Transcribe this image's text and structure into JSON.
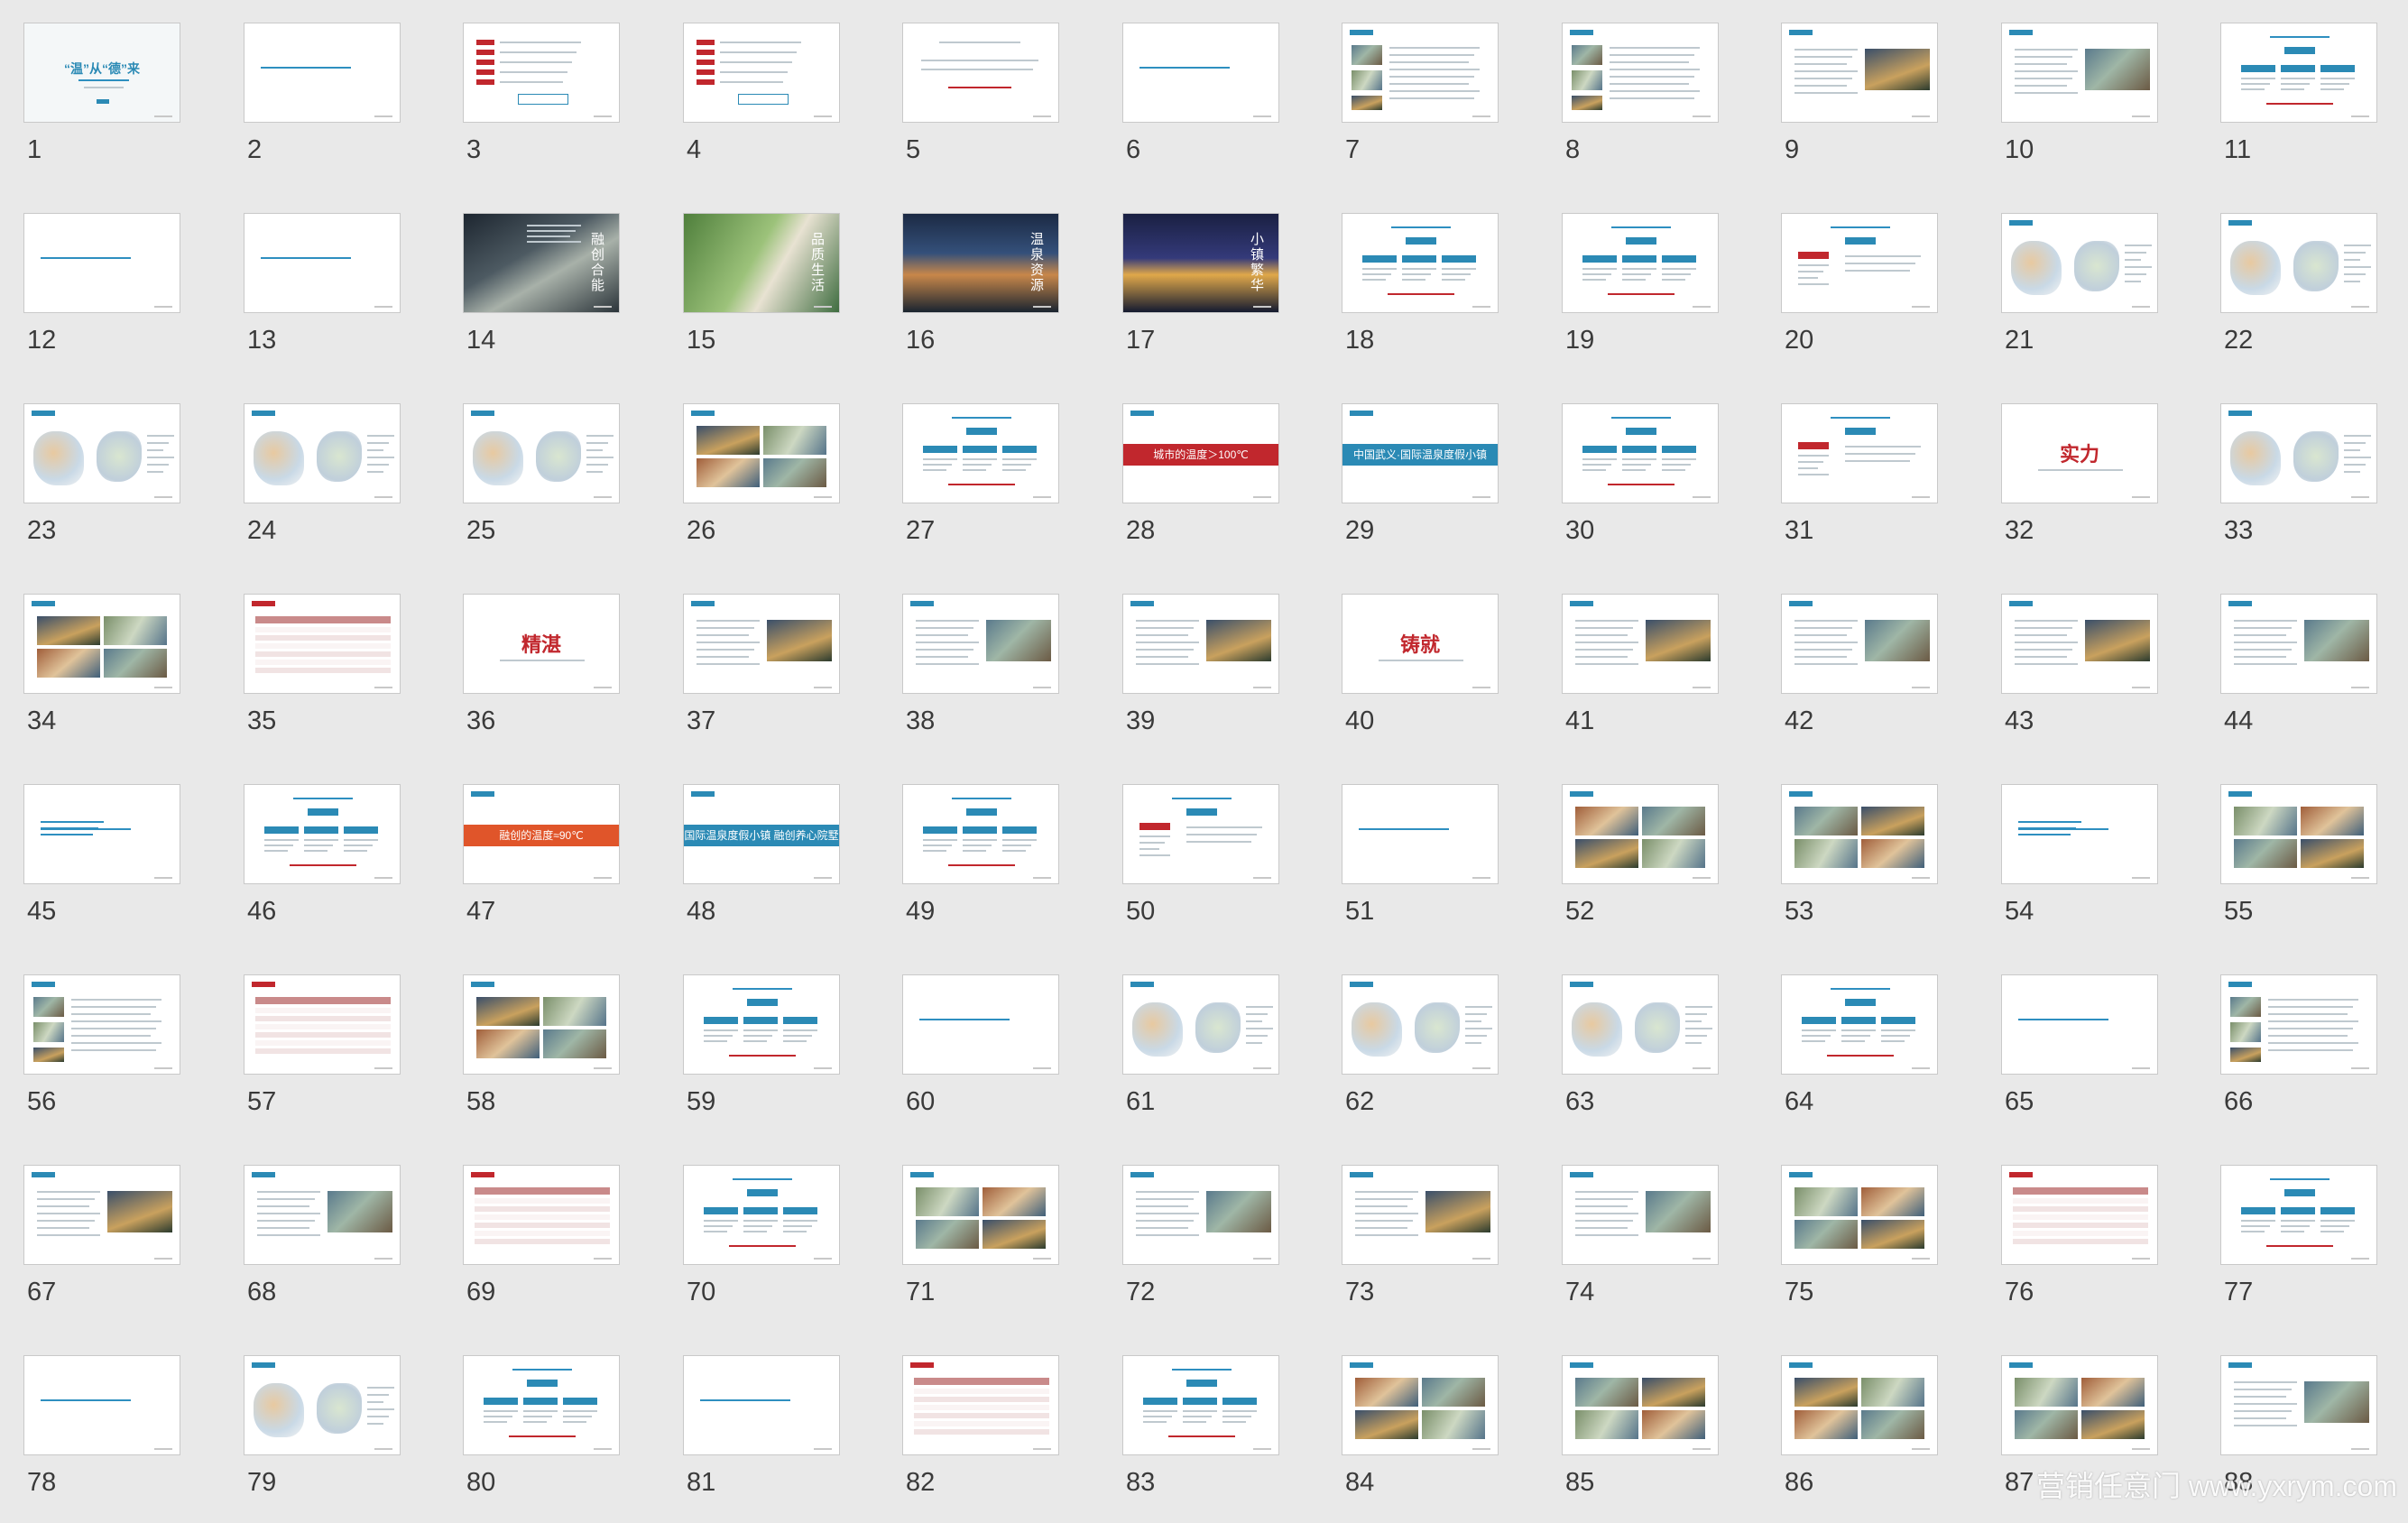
{
  "slides": [
    {
      "number": "1",
      "kind": "cover",
      "text": "“温”从“德”来"
    },
    {
      "number": "2",
      "kind": "text-blue"
    },
    {
      "number": "3",
      "kind": "list-red"
    },
    {
      "number": "4",
      "kind": "list-red"
    },
    {
      "number": "5",
      "kind": "center-lines"
    },
    {
      "number": "6",
      "kind": "text-blue"
    },
    {
      "number": "7",
      "kind": "photo-text"
    },
    {
      "number": "8",
      "kind": "photo-text"
    },
    {
      "number": "9",
      "kind": "photo-right"
    },
    {
      "number": "10",
      "kind": "photo-right"
    },
    {
      "number": "11",
      "kind": "diagram"
    },
    {
      "number": "12",
      "kind": "text-blue"
    },
    {
      "number": "13",
      "kind": "text-blue"
    },
    {
      "number": "14",
      "kind": "dark-photo",
      "text": "融创合能"
    },
    {
      "number": "15",
      "kind": "people-photo",
      "text": "品质生活"
    },
    {
      "number": "16",
      "kind": "resort-photo",
      "text": "温泉资源"
    },
    {
      "number": "17",
      "kind": "city-photo",
      "text": "小镇繁华"
    },
    {
      "number": "18",
      "kind": "diagram"
    },
    {
      "number": "19",
      "kind": "diagram"
    },
    {
      "number": "20",
      "kind": "diagram-red"
    },
    {
      "number": "21",
      "kind": "map"
    },
    {
      "number": "22",
      "kind": "map"
    },
    {
      "number": "23",
      "kind": "map"
    },
    {
      "number": "24",
      "kind": "map"
    },
    {
      "number": "25",
      "kind": "map"
    },
    {
      "number": "26",
      "kind": "photo-grid"
    },
    {
      "number": "27",
      "kind": "diagram"
    },
    {
      "number": "28",
      "kind": "red-bar",
      "text": "城市的温度＞100℃"
    },
    {
      "number": "29",
      "kind": "blue-bar",
      "text": "中国武义·国际温泉度假小镇"
    },
    {
      "number": "30",
      "kind": "diagram"
    },
    {
      "number": "31",
      "kind": "diagram-red"
    },
    {
      "number": "32",
      "kind": "big-word",
      "text": "实力"
    },
    {
      "number": "33",
      "kind": "map"
    },
    {
      "number": "34",
      "kind": "photo-grid"
    },
    {
      "number": "35",
      "kind": "table"
    },
    {
      "number": "36",
      "kind": "big-word",
      "text": "精湛"
    },
    {
      "number": "37",
      "kind": "photo-right"
    },
    {
      "number": "38",
      "kind": "photo-right"
    },
    {
      "number": "39",
      "kind": "photo-right"
    },
    {
      "number": "40",
      "kind": "big-word",
      "text": "铸就"
    },
    {
      "number": "41",
      "kind": "photo-right"
    },
    {
      "number": "42",
      "kind": "photo-right"
    },
    {
      "number": "43",
      "kind": "photo-right"
    },
    {
      "number": "44",
      "kind": "photo-right"
    },
    {
      "number": "45",
      "kind": "text-blue"
    },
    {
      "number": "46",
      "kind": "diagram"
    },
    {
      "number": "47",
      "kind": "orange-bar",
      "text": "融创的温度≈90℃"
    },
    {
      "number": "48",
      "kind": "blue-bar",
      "text": "国际温泉度假小镇 融创养心院墅"
    },
    {
      "number": "49",
      "kind": "diagram"
    },
    {
      "number": "50",
      "kind": "diagram-red"
    },
    {
      "number": "51",
      "kind": "text-blue"
    },
    {
      "number": "52",
      "kind": "photo-grid"
    },
    {
      "number": "53",
      "kind": "photo-grid"
    },
    {
      "number": "54",
      "kind": "text-blue"
    },
    {
      "number": "55",
      "kind": "photo-grid"
    },
    {
      "number": "56",
      "kind": "photo-text"
    },
    {
      "number": "57",
      "kind": "table"
    },
    {
      "number": "58",
      "kind": "photo-grid"
    },
    {
      "number": "59",
      "kind": "diagram"
    },
    {
      "number": "60",
      "kind": "text-blue"
    },
    {
      "number": "61",
      "kind": "map"
    },
    {
      "number": "62",
      "kind": "map"
    },
    {
      "number": "63",
      "kind": "map"
    },
    {
      "number": "64",
      "kind": "diagram"
    },
    {
      "number": "65",
      "kind": "text-blue"
    },
    {
      "number": "66",
      "kind": "photo-text"
    },
    {
      "number": "67",
      "kind": "photo-right"
    },
    {
      "number": "68",
      "kind": "photo-right"
    },
    {
      "number": "69",
      "kind": "table"
    },
    {
      "number": "70",
      "kind": "diagram"
    },
    {
      "number": "71",
      "kind": "photo-grid"
    },
    {
      "number": "72",
      "kind": "photo-right"
    },
    {
      "number": "73",
      "kind": "photo-right"
    },
    {
      "number": "74",
      "kind": "photo-right"
    },
    {
      "number": "75",
      "kind": "photo-grid"
    },
    {
      "number": "76",
      "kind": "table"
    },
    {
      "number": "77",
      "kind": "diagram"
    },
    {
      "number": "78",
      "kind": "text-blue"
    },
    {
      "number": "79",
      "kind": "map"
    },
    {
      "number": "80",
      "kind": "diagram"
    },
    {
      "number": "81",
      "kind": "text-blue"
    },
    {
      "number": "82",
      "kind": "table"
    },
    {
      "number": "83",
      "kind": "diagram"
    },
    {
      "number": "84",
      "kind": "photo-grid"
    },
    {
      "number": "85",
      "kind": "photo-grid"
    },
    {
      "number": "86",
      "kind": "photo-grid"
    },
    {
      "number": "87",
      "kind": "photo-grid"
    },
    {
      "number": "88",
      "kind": "photo-right"
    }
  ],
  "watermark": "营销任意门 www.yxrym.com",
  "colors": {
    "background": "#e9e9e9",
    "accent_blue": "#2b8ab5",
    "accent_red": "#c1272d",
    "accent_orange": "#e0552a"
  }
}
